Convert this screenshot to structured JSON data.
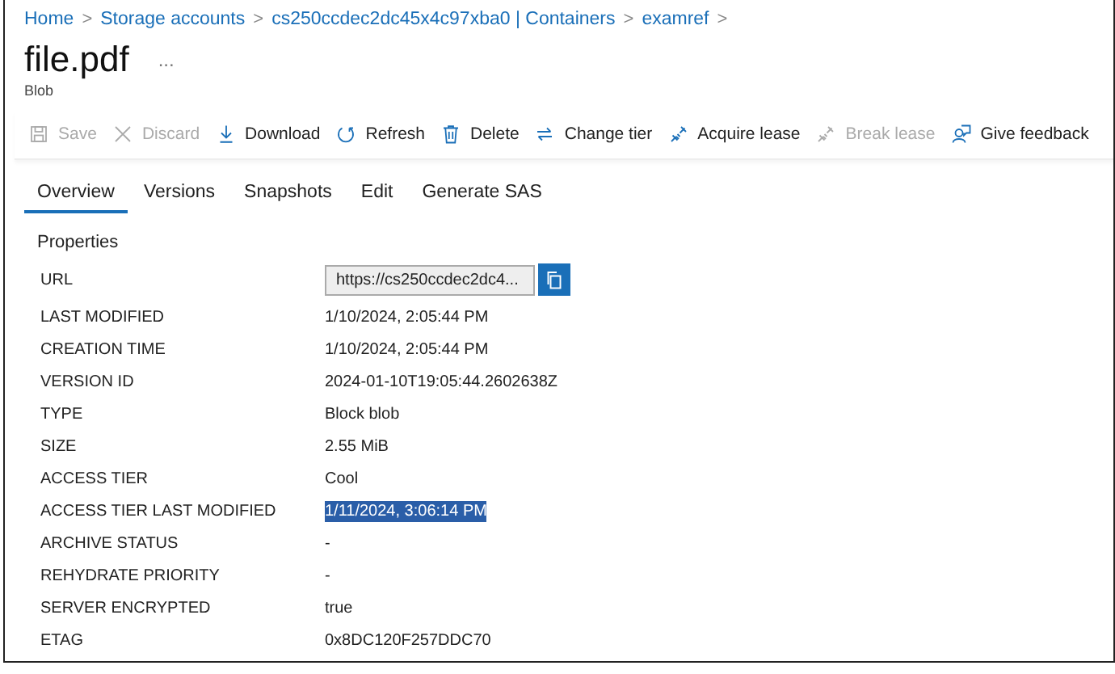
{
  "breadcrumb": [
    {
      "label": "Home"
    },
    {
      "label": "Storage accounts"
    },
    {
      "label": "cs250ccdec2dc45x4c97xba0 | Containers"
    },
    {
      "label": "examref"
    }
  ],
  "breadcrumb_separator": ">",
  "title": "file.pdf",
  "more": "...",
  "subtitle": "Blob",
  "toolbar": [
    {
      "label": "Save",
      "disabled": true
    },
    {
      "label": "Discard",
      "disabled": true
    },
    {
      "label": "Download",
      "disabled": false
    },
    {
      "label": "Refresh",
      "disabled": false
    },
    {
      "label": "Delete",
      "disabled": false
    },
    {
      "label": "Change tier",
      "disabled": false
    },
    {
      "label": "Acquire lease",
      "disabled": false
    },
    {
      "label": "Break lease",
      "disabled": true
    },
    {
      "label": "Give feedback",
      "disabled": false
    }
  ],
  "tabs": [
    {
      "label": "Overview",
      "selected": true
    },
    {
      "label": "Versions",
      "selected": false
    },
    {
      "label": "Snapshots",
      "selected": false
    },
    {
      "label": "Edit",
      "selected": false
    },
    {
      "label": "Generate SAS",
      "selected": false
    }
  ],
  "section_title": "Properties",
  "properties": [
    {
      "kind": "url",
      "label": "URL",
      "value": "https://cs250ccdec2dc4..."
    },
    {
      "kind": "text",
      "label": "LAST MODIFIED",
      "value": "1/10/2024, 2:05:44 PM",
      "highlighted": false
    },
    {
      "kind": "text",
      "label": "CREATION TIME",
      "value": "1/10/2024, 2:05:44 PM",
      "highlighted": false
    },
    {
      "kind": "text",
      "label": "VERSION ID",
      "value": "2024-01-10T19:05:44.2602638Z",
      "highlighted": false
    },
    {
      "kind": "text",
      "label": "TYPE",
      "value": "Block blob",
      "highlighted": false
    },
    {
      "kind": "text",
      "label": "SIZE",
      "value": "2.55 MiB",
      "highlighted": false
    },
    {
      "kind": "text",
      "label": "ACCESS TIER",
      "value": "Cool",
      "highlighted": false
    },
    {
      "kind": "text",
      "label": "ACCESS TIER LAST MODIFIED",
      "value": "1/11/2024, 3:06:14 PM",
      "highlighted": true
    },
    {
      "kind": "text",
      "label": "ARCHIVE STATUS",
      "value": "-",
      "highlighted": false
    },
    {
      "kind": "text",
      "label": "REHYDRATE PRIORITY",
      "value": "-",
      "highlighted": false
    },
    {
      "kind": "text",
      "label": "SERVER ENCRYPTED",
      "value": "true",
      "highlighted": false
    },
    {
      "kind": "text",
      "label": "ETAG",
      "value": "0x8DC120F257DDC70",
      "highlighted": false
    }
  ]
}
